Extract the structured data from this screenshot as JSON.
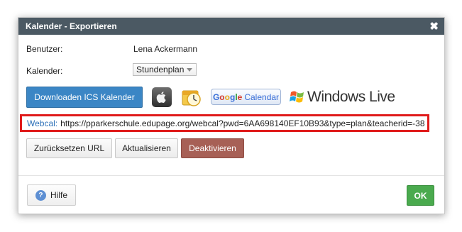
{
  "dialog": {
    "title": "Kalender - Exportieren",
    "close_glyph": "✖"
  },
  "fields": {
    "user_label": "Benutzer:",
    "user_value": "Lena Ackermann",
    "calendar_label": "Kalender:",
    "calendar_selected": "Stundenplan"
  },
  "export": {
    "download_ics_label": "Downloaden ICS Kalender",
    "apple_icon": "apple-icon",
    "outlook_icon": "outlook-icon",
    "google_calendar": {
      "g": "G",
      "o1": "o",
      "o2": "o",
      "g2": "g",
      "l": "l",
      "e": "e",
      "cal": "Calendar"
    },
    "windows_live_text": "Windows Live"
  },
  "webcal": {
    "label": "Webcal:",
    "url": "https://pparkerschule.edupage.org/webcal?pwd=6AA698140EF10B93&type=plan&teacherid=-38"
  },
  "actions": {
    "reset_url": "Zurücksetzen URL",
    "update": "Aktualisieren",
    "deactivate": "Deaktivieren"
  },
  "footer": {
    "help_label": "Hilfe",
    "help_glyph": "?",
    "ok_label": "OK"
  },
  "colors": {
    "titlebar": "#4b5963",
    "primary": "#3b86c5",
    "danger": "#a76056",
    "ok": "#4aaa4e",
    "highlight_border": "#e01b1b"
  }
}
